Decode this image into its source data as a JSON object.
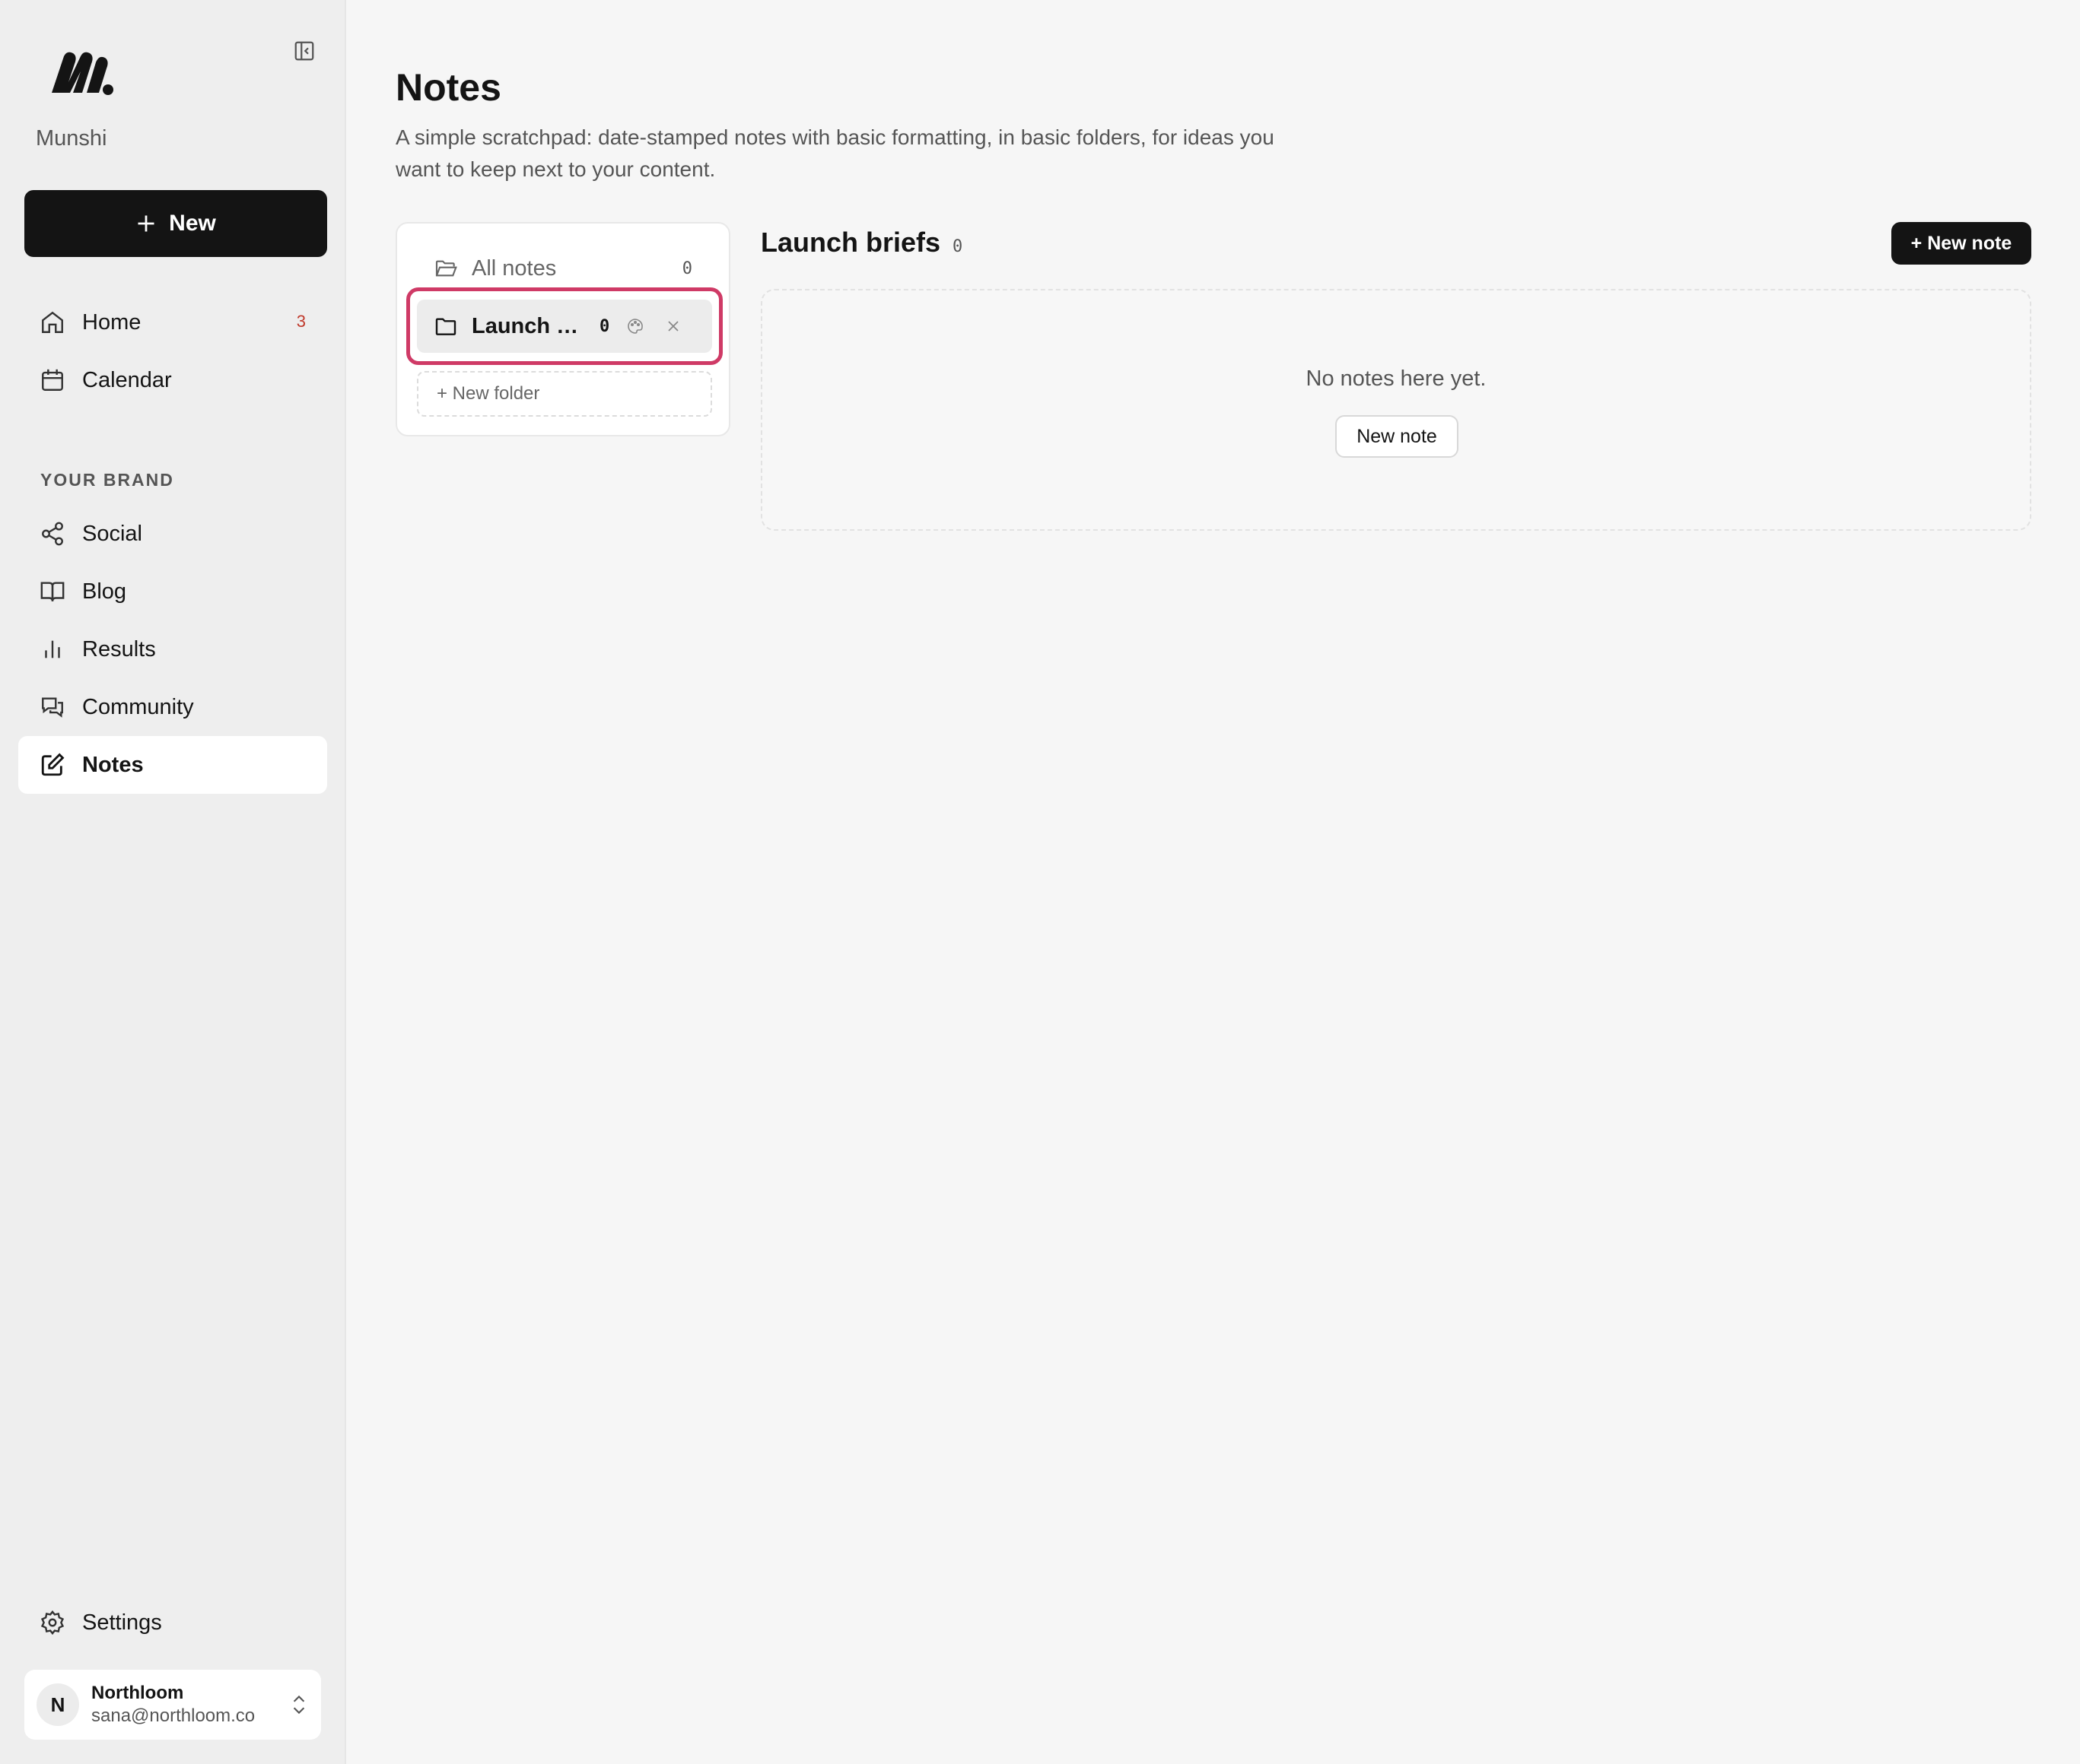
{
  "sidebar": {
    "brand": "Munshi",
    "new_button": "New",
    "nav": [
      {
        "label": "Home",
        "icon": "home-icon",
        "badge": "3"
      },
      {
        "label": "Calendar",
        "icon": "calendar-icon"
      }
    ],
    "section_label": "YOUR BRAND",
    "brand_nav": [
      {
        "label": "Social",
        "icon": "share-icon"
      },
      {
        "label": "Blog",
        "icon": "book-icon"
      },
      {
        "label": "Results",
        "icon": "bar-chart-icon"
      },
      {
        "label": "Community",
        "icon": "chat-icon"
      },
      {
        "label": "Notes",
        "icon": "edit-icon",
        "active": true
      }
    ],
    "settings": "Settings",
    "account": {
      "initial": "N",
      "name": "Northloom",
      "email": "sana@northloom.co"
    }
  },
  "main": {
    "title": "Notes",
    "description": "A simple scratchpad: date-stamped notes with basic formatting, in basic folders, for ideas you want to keep next to your content.",
    "folders": {
      "all": {
        "label": "All notes",
        "count": "0"
      },
      "selected": {
        "label": "Launch b...",
        "count": "0"
      },
      "new_folder": "+ New folder"
    },
    "folder_view": {
      "title": "Launch briefs",
      "count": "0",
      "new_note_button": "+ New note",
      "empty_text": "No notes here yet.",
      "empty_button": "New note"
    }
  },
  "colors": {
    "accent_dark": "#141414",
    "highlight": "#cf3a66",
    "badge": "#c0392b"
  }
}
